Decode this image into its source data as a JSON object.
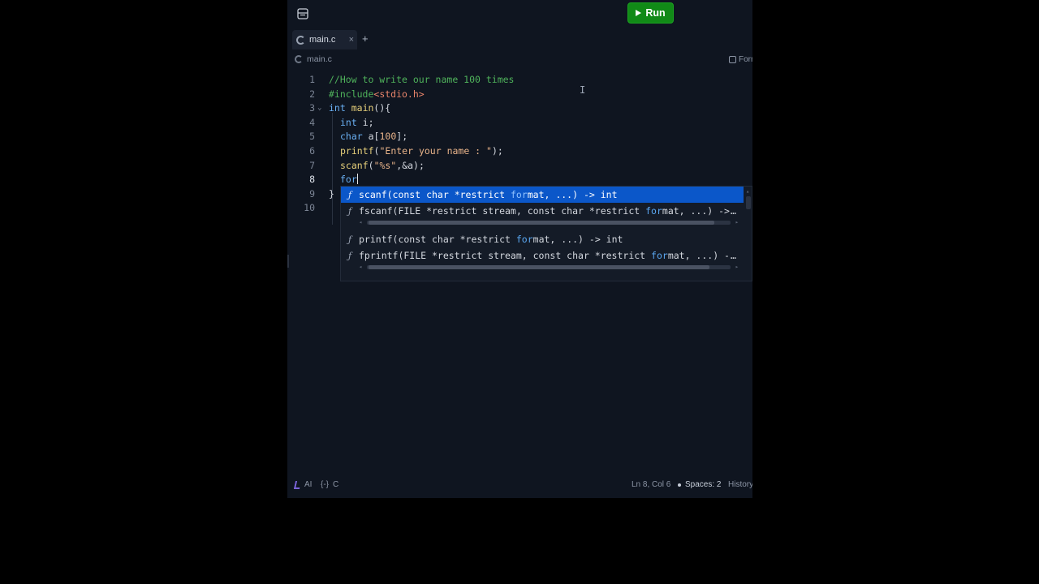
{
  "toolbar": {
    "run_label": "Run"
  },
  "tabs": [
    {
      "label": "main.c",
      "close": "×"
    }
  ],
  "tab_add": "+",
  "breadcrumb": {
    "file": "main.c"
  },
  "format_label": "Format",
  "editor": {
    "line_numbers": [
      "1",
      "2",
      "3",
      "4",
      "5",
      "6",
      "7",
      "8",
      "9",
      "10"
    ],
    "active_line": "8",
    "fold_marker": "⌄"
  },
  "code": {
    "l1": "//How to write our name 100 times",
    "l2_pp": "#include",
    "l2_hdr": "<stdio.h>",
    "l3_kw": "int",
    "l3_fn": "main",
    "l3_rest": "(){",
    "l4_kw": "int",
    "l4_rest": " i;",
    "l5_kw": "char",
    "l5_rest": " a[",
    "l5_num": "100",
    "l5_end": "];",
    "l6_fn": "printf",
    "l6_open": "(",
    "l6_str": "\"Enter your name : \"",
    "l6_end": ");",
    "l7_fn": "scanf",
    "l7_open": "(",
    "l7_str": "\"%s\"",
    "l7_end": ",&a);",
    "l8_kw": "for",
    "l9": "}"
  },
  "autocomplete": {
    "icon": "ƒ",
    "items": [
      {
        "pre": "scanf(const char *restrict ",
        "match": "for",
        "post": "mat, ...) -> int",
        "ellipsis": ""
      },
      {
        "pre": "fscanf(FILE *restrict stream, const char *restrict ",
        "match": "for",
        "post": "mat, ...) ->",
        "ellipsis": "…"
      },
      {
        "pre": "printf(const char *restrict ",
        "match": "for",
        "post": "mat, ...) -> int",
        "ellipsis": ""
      },
      {
        "pre": "fprintf(FILE *restrict stream, const char *restrict ",
        "match": "for",
        "post": "mat, ...) -",
        "ellipsis": "…"
      }
    ],
    "selected_index": 0
  },
  "status": {
    "ai_label": "AI",
    "lang_icon": "{-}",
    "lang_label": "C",
    "position": "Ln 8, Col 6",
    "spaces": "Spaces: 2",
    "history": "History"
  },
  "colors": {
    "run_green": "#118a17",
    "selection_blue": "#0b57c9",
    "editor_bg": "#0f1520"
  }
}
